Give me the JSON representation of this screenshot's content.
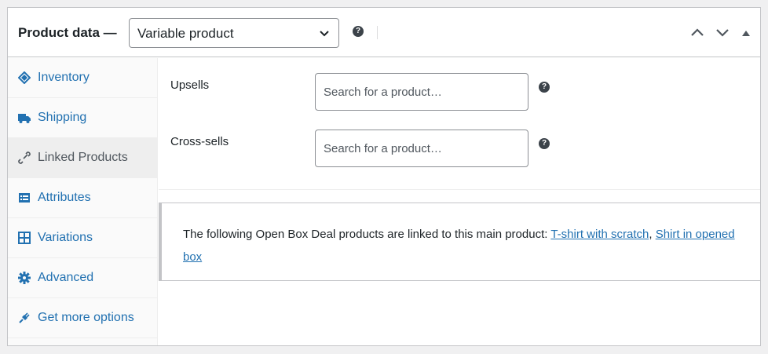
{
  "header": {
    "title": "Product data —",
    "product_type": "Variable product"
  },
  "sidebar": {
    "items": [
      {
        "label": "Inventory",
        "icon": "inventory-icon",
        "active": false
      },
      {
        "label": "Shipping",
        "icon": "truck-icon",
        "active": false
      },
      {
        "label": "Linked Products",
        "icon": "link-icon",
        "active": true
      },
      {
        "label": "Attributes",
        "icon": "attributes-list-icon",
        "active": false
      },
      {
        "label": "Variations",
        "icon": "grid-icon",
        "active": false
      },
      {
        "label": "Advanced",
        "icon": "gear-icon",
        "active": false
      },
      {
        "label": "Get more options",
        "icon": "plug-icon",
        "active": false
      }
    ]
  },
  "fields": {
    "upsells": {
      "label": "Upsells",
      "placeholder": "Search for a product…",
      "value": ""
    },
    "crosssells": {
      "label": "Cross-sells",
      "placeholder": "Search for a product…",
      "value": ""
    }
  },
  "notice": {
    "text": "The following Open Box Deal products are linked to this main product: ",
    "links": [
      "T-shirt with scratch",
      "Shirt in opened box"
    ],
    "separator": ", "
  },
  "colors": {
    "link": "#2271b1",
    "border": "#c3c4c7",
    "active_tab_bg": "#eeeeee"
  }
}
